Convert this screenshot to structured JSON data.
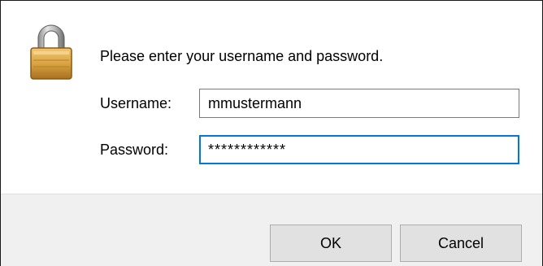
{
  "dialog": {
    "prompt": "Please enter your username and password.",
    "username_label": "Username:",
    "username_value": "mmustermann",
    "password_label": "Password:",
    "password_value": "************",
    "ok_label": "OK",
    "cancel_label": "Cancel",
    "icon": "padlock-icon"
  },
  "colors": {
    "focus_border": "#0078d7",
    "footer_bg": "#f0f0f0",
    "button_bg": "#e1e1e1",
    "padlock_body": "#d9a441"
  }
}
